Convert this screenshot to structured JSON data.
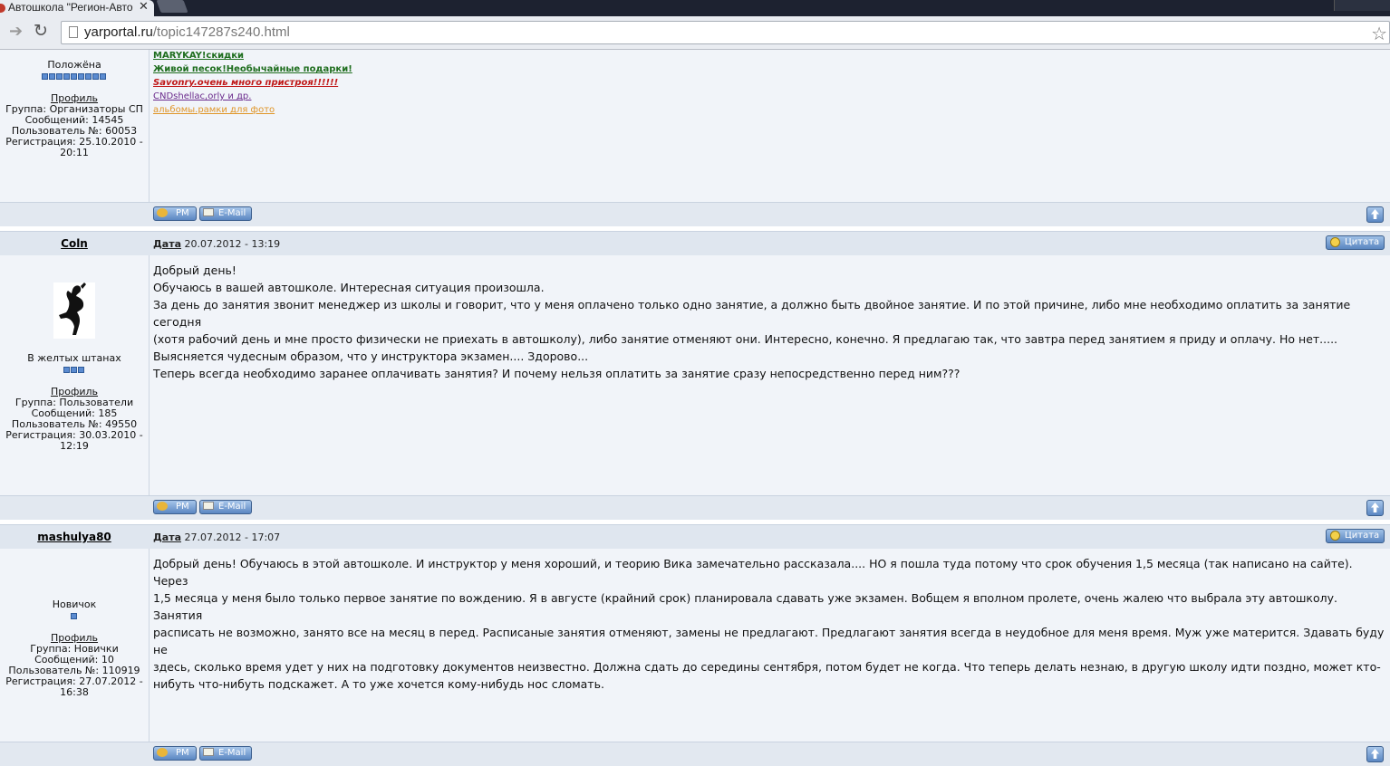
{
  "browser": {
    "tab_title": "Автошкола \"Регион-Авто",
    "url_host": "yarportal.ru",
    "url_path": "/topic147287s240.html"
  },
  "post_top": {
    "rank": "Положёна",
    "pips": 9,
    "profile_label": "Профиль",
    "info": [
      "Группа: Организаторы СП",
      "Сообщений: 14545",
      "Пользователь №: 60053",
      "Регистрация: 25.10.2010 -",
      "20:11"
    ],
    "signature": [
      {
        "text": "MARYKAY!скидки ",
        "color": "#1f6e1f",
        "bold": true,
        "italic": false
      },
      {
        "text": "Живой песок!Необычайные подарки! ",
        "color": "#1f6e1f",
        "bold": true,
        "italic": false
      },
      {
        "text": "Savonry.очень много пристроя!!!!!! ",
        "color": "#c01818",
        "bold": true,
        "italic": true
      },
      {
        "text": "CNDshellac,orly и др. ",
        "color": "#6a2a8c",
        "bold": false,
        "italic": false
      },
      {
        "text": "альбомы.рамки для фото",
        "color": "#e0962a",
        "bold": false,
        "italic": false
      }
    ]
  },
  "buttons": {
    "pm": "PM",
    "email": "E-Mail",
    "quote": "Цитата",
    "date_label": "Дата"
  },
  "post_coln": {
    "author": "Coln",
    "date": "20.07.2012 - 13:19",
    "rank": "В желтых штанах",
    "pips": 3,
    "profile_label": "Профиль",
    "info": [
      "Группа: Пользователи",
      "Сообщений: 185",
      "Пользователь №: 49550",
      "Регистрация: 30.03.2010 -",
      "12:19"
    ],
    "lines": [
      "Добрый день!",
      "Обучаюсь в вашей автошколе. Интересная ситуация произошла.",
      "За день до занятия звонит менеджер из школы и говорит, что у меня оплачено только одно занятие, а должно быть двойное занятие. И по этой причине, либо мне необходимо оплатить за занятие сегодня",
      "(хотя рабочий день и мне просто физически не приехать в автошколу), либо занятие отменяют они. Интересно, конечно. Я предлагаю так, что завтра перед занятием я приду и оплачу. Но нет.....",
      "Выясняется чудесным образом, что у инструктора экзамен.... Здорово...",
      "Теперь всегда необходимо заранее оплачивать занятия? И почему нельзя оплатить за занятие сразу непосредственно перед ним???"
    ]
  },
  "post_mashulya": {
    "author": "mashulya80",
    "date": "27.07.2012 - 17:07",
    "rank": "Новичок",
    "pips": 1,
    "profile_label": "Профиль",
    "info": [
      "Группа: Новички",
      "Сообщений: 10",
      "Пользователь №: 110919",
      "Регистрация: 27.07.2012 -",
      "16:38"
    ],
    "lines": [
      "Добрый день! Обучаюсь в этой автошколе. И инструктор у меня хороший, и теорию Вика замечательно рассказала.... НО я пошла туда потому что срок обучения 1,5 месяца (так написано на сайте). Через",
      "1,5 месяца у меня было только первое занятие по вождению. Я в августе (крайний срок) планировала сдавать уже экзамен. Вобщем я вполном пролете, очень жалею что выбрала эту автошколу. Занятия",
      "расписать не возможно, занято все на месяц в перед. Расписаные занятия отменяют, замены не предлагают. Предлагают занятия всегда в неудобное для меня время. Муж уже матерится. Здавать буду не",
      "здесь, сколько время удет у них на подготовку документов неизвестно. Должна сдать до середины сентября, потом будет не когда. Что теперь делать незнаю, в другую школу идти поздно, может кто-",
      "нибуть что-нибуть подскажет. А то уже хочется кому-нибудь нос сломать."
    ]
  }
}
